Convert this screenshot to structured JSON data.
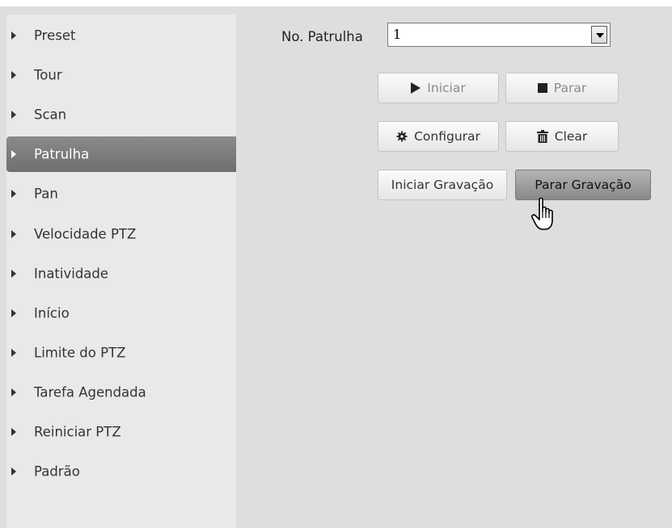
{
  "sidebar": {
    "items": [
      {
        "label": "Preset"
      },
      {
        "label": "Tour"
      },
      {
        "label": "Scan"
      },
      {
        "label": "Patrulha",
        "active": true
      },
      {
        "label": "Pan"
      },
      {
        "label": "Velocidade PTZ"
      },
      {
        "label": "Inatividade"
      },
      {
        "label": "Início"
      },
      {
        "label": "Limite do PTZ"
      },
      {
        "label": "Tarefa Agendada"
      },
      {
        "label": "Reiniciar PTZ"
      },
      {
        "label": "Padrão"
      }
    ]
  },
  "patrol": {
    "label": "No. Patrulha",
    "selected": "1"
  },
  "buttons": {
    "start": "Iniciar",
    "stop": "Parar",
    "configure": "Configurar",
    "clear": "Clear",
    "start_record": "Iniciar Gravação",
    "stop_record": "Parar Gravação"
  },
  "icons": {
    "menu_arrow": "triangle-right-icon",
    "start": "play-icon",
    "stop": "stop-icon",
    "configure": "gear-icon",
    "clear": "trash-icon",
    "cursor": "hand-pointer-icon"
  },
  "colors": {
    "background": "#dedede",
    "sidebar": "#e9e9e9",
    "active_item": "#7a7a7a"
  }
}
